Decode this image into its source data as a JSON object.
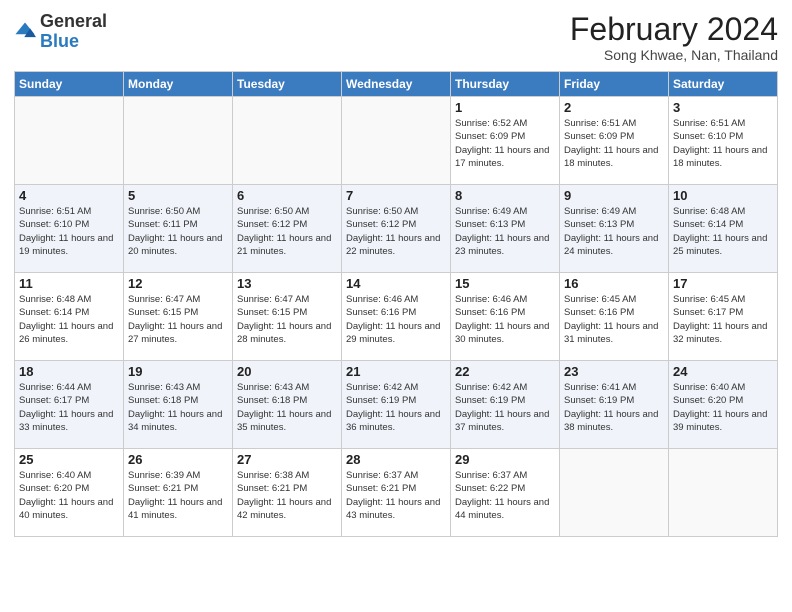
{
  "header": {
    "logo_general": "General",
    "logo_blue": "Blue",
    "title": "February 2024",
    "location": "Song Khwae, Nan, Thailand"
  },
  "days_of_week": [
    "Sunday",
    "Monday",
    "Tuesday",
    "Wednesday",
    "Thursday",
    "Friday",
    "Saturday"
  ],
  "weeks": [
    {
      "days": [
        {
          "num": "",
          "info": ""
        },
        {
          "num": "",
          "info": ""
        },
        {
          "num": "",
          "info": ""
        },
        {
          "num": "",
          "info": ""
        },
        {
          "num": "1",
          "info": "Sunrise: 6:52 AM\nSunset: 6:09 PM\nDaylight: 11 hours and 17 minutes."
        },
        {
          "num": "2",
          "info": "Sunrise: 6:51 AM\nSunset: 6:09 PM\nDaylight: 11 hours and 18 minutes."
        },
        {
          "num": "3",
          "info": "Sunrise: 6:51 AM\nSunset: 6:10 PM\nDaylight: 11 hours and 18 minutes."
        }
      ]
    },
    {
      "days": [
        {
          "num": "4",
          "info": "Sunrise: 6:51 AM\nSunset: 6:10 PM\nDaylight: 11 hours and 19 minutes."
        },
        {
          "num": "5",
          "info": "Sunrise: 6:50 AM\nSunset: 6:11 PM\nDaylight: 11 hours and 20 minutes."
        },
        {
          "num": "6",
          "info": "Sunrise: 6:50 AM\nSunset: 6:12 PM\nDaylight: 11 hours and 21 minutes."
        },
        {
          "num": "7",
          "info": "Sunrise: 6:50 AM\nSunset: 6:12 PM\nDaylight: 11 hours and 22 minutes."
        },
        {
          "num": "8",
          "info": "Sunrise: 6:49 AM\nSunset: 6:13 PM\nDaylight: 11 hours and 23 minutes."
        },
        {
          "num": "9",
          "info": "Sunrise: 6:49 AM\nSunset: 6:13 PM\nDaylight: 11 hours and 24 minutes."
        },
        {
          "num": "10",
          "info": "Sunrise: 6:48 AM\nSunset: 6:14 PM\nDaylight: 11 hours and 25 minutes."
        }
      ]
    },
    {
      "days": [
        {
          "num": "11",
          "info": "Sunrise: 6:48 AM\nSunset: 6:14 PM\nDaylight: 11 hours and 26 minutes."
        },
        {
          "num": "12",
          "info": "Sunrise: 6:47 AM\nSunset: 6:15 PM\nDaylight: 11 hours and 27 minutes."
        },
        {
          "num": "13",
          "info": "Sunrise: 6:47 AM\nSunset: 6:15 PM\nDaylight: 11 hours and 28 minutes."
        },
        {
          "num": "14",
          "info": "Sunrise: 6:46 AM\nSunset: 6:16 PM\nDaylight: 11 hours and 29 minutes."
        },
        {
          "num": "15",
          "info": "Sunrise: 6:46 AM\nSunset: 6:16 PM\nDaylight: 11 hours and 30 minutes."
        },
        {
          "num": "16",
          "info": "Sunrise: 6:45 AM\nSunset: 6:16 PM\nDaylight: 11 hours and 31 minutes."
        },
        {
          "num": "17",
          "info": "Sunrise: 6:45 AM\nSunset: 6:17 PM\nDaylight: 11 hours and 32 minutes."
        }
      ]
    },
    {
      "days": [
        {
          "num": "18",
          "info": "Sunrise: 6:44 AM\nSunset: 6:17 PM\nDaylight: 11 hours and 33 minutes."
        },
        {
          "num": "19",
          "info": "Sunrise: 6:43 AM\nSunset: 6:18 PM\nDaylight: 11 hours and 34 minutes."
        },
        {
          "num": "20",
          "info": "Sunrise: 6:43 AM\nSunset: 6:18 PM\nDaylight: 11 hours and 35 minutes."
        },
        {
          "num": "21",
          "info": "Sunrise: 6:42 AM\nSunset: 6:19 PM\nDaylight: 11 hours and 36 minutes."
        },
        {
          "num": "22",
          "info": "Sunrise: 6:42 AM\nSunset: 6:19 PM\nDaylight: 11 hours and 37 minutes."
        },
        {
          "num": "23",
          "info": "Sunrise: 6:41 AM\nSunset: 6:19 PM\nDaylight: 11 hours and 38 minutes."
        },
        {
          "num": "24",
          "info": "Sunrise: 6:40 AM\nSunset: 6:20 PM\nDaylight: 11 hours and 39 minutes."
        }
      ]
    },
    {
      "days": [
        {
          "num": "25",
          "info": "Sunrise: 6:40 AM\nSunset: 6:20 PM\nDaylight: 11 hours and 40 minutes."
        },
        {
          "num": "26",
          "info": "Sunrise: 6:39 AM\nSunset: 6:21 PM\nDaylight: 11 hours and 41 minutes."
        },
        {
          "num": "27",
          "info": "Sunrise: 6:38 AM\nSunset: 6:21 PM\nDaylight: 11 hours and 42 minutes."
        },
        {
          "num": "28",
          "info": "Sunrise: 6:37 AM\nSunset: 6:21 PM\nDaylight: 11 hours and 43 minutes."
        },
        {
          "num": "29",
          "info": "Sunrise: 6:37 AM\nSunset: 6:22 PM\nDaylight: 11 hours and 44 minutes."
        },
        {
          "num": "",
          "info": ""
        },
        {
          "num": "",
          "info": ""
        }
      ]
    }
  ]
}
